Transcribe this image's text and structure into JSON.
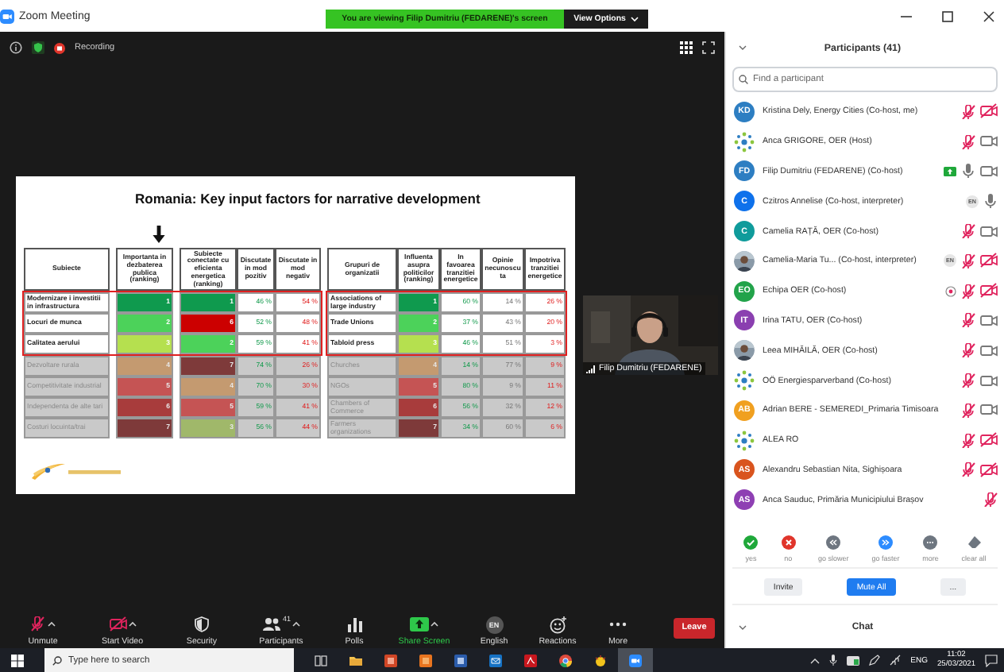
{
  "window": {
    "title": "Zoom Meeting"
  },
  "share_banner": {
    "text": "You are viewing Filip Dumitriu (FEDARENE)'s screen",
    "button": "View Options"
  },
  "meeting_bar": {
    "recording": "Recording"
  },
  "slide": {
    "title": "Romania: Key input factors for narrative development",
    "left_table": {
      "columns": [
        "Subiecte",
        "Importanta in dezbaterea publica (ranking)",
        "Subiecte conectate cu eficienta energetica (ranking)",
        "Discutate in mod pozitiv",
        "Discutate in mod negativ"
      ],
      "rows": [
        {
          "subject": "Modernizare i investitii in infrastructura",
          "importance": {
            "rank": "1",
            "color": "#0f9a4e"
          },
          "efficiency": {
            "rank": "1",
            "color": "#0f9a4e"
          },
          "positive": "46 %",
          "negative": "54 %",
          "highlighted": true
        },
        {
          "subject": "Locuri de munca",
          "importance": {
            "rank": "2",
            "color": "#4cd25a"
          },
          "efficiency": {
            "rank": "6",
            "color": "#cc0000"
          },
          "positive": "52 %",
          "negative": "48 %",
          "highlighted": true
        },
        {
          "subject": "Calitatea aerului",
          "importance": {
            "rank": "3",
            "color": "#b5e04f"
          },
          "efficiency": {
            "rank": "2",
            "color": "#4cd25a"
          },
          "positive": "59 %",
          "negative": "41 %",
          "highlighted": true
        },
        {
          "subject": "Dezvoltare rurala",
          "importance": {
            "rank": "4",
            "color": "#c49a70"
          },
          "efficiency": {
            "rank": "7",
            "color": "#7e3a3a"
          },
          "positive": "74 %",
          "negative": "26 %",
          "highlighted": false
        },
        {
          "subject": "Competitivitate industrial",
          "importance": {
            "rank": "5",
            "color": "#c55454"
          },
          "efficiency": {
            "rank": "4",
            "color": "#c49a70"
          },
          "positive": "70 %",
          "negative": "30 %",
          "highlighted": false
        },
        {
          "subject": "Independenta de alte tari",
          "importance": {
            "rank": "6",
            "color": "#a83c3c"
          },
          "efficiency": {
            "rank": "5",
            "color": "#c55454"
          },
          "positive": "59 %",
          "negative": "41 %",
          "highlighted": false
        },
        {
          "subject": "Costuri locuinta/trai",
          "importance": {
            "rank": "7",
            "color": "#7e3a3a"
          },
          "efficiency": {
            "rank": "3",
            "color": "#a0b86a"
          },
          "positive": "56 %",
          "negative": "44 %",
          "highlighted": false
        }
      ]
    },
    "right_table": {
      "columns": [
        "Grupuri de organizatii",
        "Influenta asupra politicilor (ranking)",
        "In favoarea tranzitiei energetice",
        "Opinie necunoscuta",
        "Impotriva tranzitiei energetice"
      ],
      "rows": [
        {
          "group": "Associations of large industry",
          "influence": {
            "rank": "1",
            "color": "#0f9a4e"
          },
          "favor": "60 %",
          "unknown": "14 %",
          "against": "26 %",
          "highlighted": true
        },
        {
          "group": "Trade Unions",
          "influence": {
            "rank": "2",
            "color": "#4cd25a"
          },
          "favor": "37 %",
          "unknown": "43 %",
          "against": "20 %",
          "highlighted": true
        },
        {
          "group": "Tabloid press",
          "influence": {
            "rank": "3",
            "color": "#b5e04f"
          },
          "favor": "46 %",
          "unknown": "51 %",
          "against": "3 %",
          "highlighted": true
        },
        {
          "group": "Churches",
          "influence": {
            "rank": "4",
            "color": "#c49a70"
          },
          "favor": "14 %",
          "unknown": "77 %",
          "against": "9 %",
          "highlighted": false
        },
        {
          "group": "NGOs",
          "influence": {
            "rank": "5",
            "color": "#c55454"
          },
          "favor": "80 %",
          "unknown": "9 %",
          "against": "11 %",
          "highlighted": false
        },
        {
          "group": "Chambers of Commerce",
          "influence": {
            "rank": "6",
            "color": "#a83c3c"
          },
          "favor": "56 %",
          "unknown": "32 %",
          "against": "12 %",
          "highlighted": false
        },
        {
          "group": "Farmers organizations",
          "influence": {
            "rank": "7",
            "color": "#7e3a3a"
          },
          "favor": "34 %",
          "unknown": "60 %",
          "against": "6 %",
          "highlighted": false
        }
      ]
    }
  },
  "video_tile": {
    "name": "Filip Dumitriu (FEDARENE)"
  },
  "toolbar": {
    "items": [
      {
        "kind": "unmute",
        "label": "Unmute",
        "menu": true
      },
      {
        "kind": "video",
        "label": "Start Video",
        "menu": true
      },
      {
        "kind": "security",
        "label": "Security",
        "menu": false
      },
      {
        "kind": "participants",
        "label": "Participants",
        "count": "41",
        "menu": true
      },
      {
        "kind": "polls",
        "label": "Polls",
        "menu": false
      },
      {
        "kind": "share",
        "label": "Share Screen",
        "menu": true
      },
      {
        "kind": "interpretation",
        "label": "English",
        "badge": "EN",
        "menu": false
      },
      {
        "kind": "reactions",
        "label": "Reactions",
        "menu": false
      },
      {
        "kind": "more",
        "label": "More",
        "menu": false
      }
    ],
    "leave": "Leave"
  },
  "participants": {
    "title": "Participants (41)",
    "search": {
      "placeholder": "Find a participant"
    },
    "items": [
      {
        "kind": "initials",
        "initials": "KD",
        "color": "#2d7ec2",
        "name": "Kristina Dely, Energy Cities (Co-host, me)",
        "muted": true,
        "camera_on": false
      },
      {
        "kind": "logo",
        "name": "Anca GRIGORE, OER (Host)",
        "muted": true,
        "camera_on": true
      },
      {
        "kind": "initials",
        "initials": "FD",
        "color": "#2d7ec2",
        "name": "Filip Dumitriu (FEDARENE) (Co-host)",
        "sharing": true,
        "muted": false,
        "camera_on": true
      },
      {
        "kind": "initials",
        "initials": "C",
        "color": "#0e71eb",
        "name": "Czitros Annelise (Co-host, interpreter)",
        "badge": "EN",
        "muted": false
      },
      {
        "kind": "initials",
        "initials": "C",
        "color": "#0f9b9b",
        "name": "Camelia RAȚĂ, OER (Co-host)",
        "muted": true,
        "camera_on": true
      },
      {
        "name": "Camelia-Maria Tu... (Co-host, interpreter)",
        "badge": "EN",
        "muted": true,
        "camera_on": false
      },
      {
        "kind": "initials",
        "initials": "EO",
        "color": "#22a34a",
        "name": "Echipa OER (Co-host)",
        "spotlight": true,
        "muted": true,
        "camera_on": false
      },
      {
        "kind": "initials",
        "initials": "IT",
        "color": "#8a3fb0",
        "name": "Irina TATU, OER (Co-host)",
        "muted": true,
        "camera_on": true
      },
      {
        "name": "Leea MIHĂILĂ, OER (Co-host)",
        "muted": true,
        "camera_on": true
      },
      {
        "kind": "logo",
        "name": "OÖ Energiesparverband (Co-host)",
        "muted": true,
        "camera_on": true
      },
      {
        "kind": "initials",
        "initials": "AB",
        "color": "#f0a020",
        "name": "Adrian BERE - SEMEREDI_Primaria Timisoara",
        "muted": true,
        "camera_on": true
      },
      {
        "kind": "logo",
        "name": "ALEA RO",
        "muted": true,
        "camera_on": false
      },
      {
        "kind": "initials",
        "initials": "AS",
        "color": "#d9541e",
        "name": "Alexandru Sebastian Nita, Sighișoara",
        "muted": true,
        "camera_on": false
      },
      {
        "kind": "initials",
        "initials": "AS",
        "color": "#8e3fb3",
        "name": "Anca Sauduc, Primăria Municipiului Brașov",
        "muted": true
      }
    ],
    "reactions": [
      {
        "kind": "yes",
        "label": "yes"
      },
      {
        "kind": "no",
        "label": "no"
      },
      {
        "kind": "slower",
        "label": "go slower"
      },
      {
        "kind": "faster",
        "label": "go faster"
      },
      {
        "kind": "more",
        "label": "more"
      },
      {
        "kind": "clear",
        "label": "clear all"
      }
    ],
    "buttons": [
      {
        "label": "Invite",
        "primary": false
      },
      {
        "label": "Mute All",
        "primary": true
      },
      {
        "label": "...",
        "primary": false
      }
    ]
  },
  "chat": {
    "title": "Chat"
  },
  "taskbar": {
    "search": {
      "placeholder": "Type here to search"
    },
    "language": "ENG",
    "time": "11:02",
    "date": "25/03/2021"
  }
}
